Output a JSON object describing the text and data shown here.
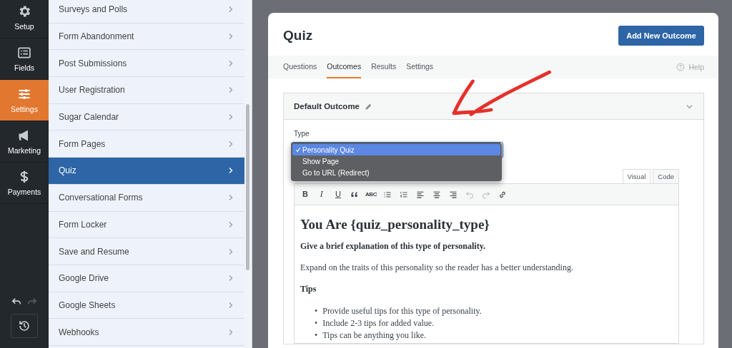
{
  "nav": [
    {
      "label": "Setup",
      "selected": false
    },
    {
      "label": "Fields",
      "selected": false
    },
    {
      "label": "Settings",
      "selected": true
    },
    {
      "label": "Marketing",
      "selected": false
    },
    {
      "label": "Payments",
      "selected": false
    }
  ],
  "nav_footer": {
    "undo_disabled": false,
    "redo_disabled": true
  },
  "menu": [
    {
      "label": "Surveys and Polls",
      "selected": false
    },
    {
      "label": "Form Abandonment",
      "selected": false
    },
    {
      "label": "Post Submissions",
      "selected": false
    },
    {
      "label": "User Registration",
      "selected": false
    },
    {
      "label": "Sugar Calendar",
      "selected": false
    },
    {
      "label": "Form Pages",
      "selected": false
    },
    {
      "label": "Quiz",
      "selected": true
    },
    {
      "label": "Conversational Forms",
      "selected": false
    },
    {
      "label": "Form Locker",
      "selected": false
    },
    {
      "label": "Save and Resume",
      "selected": false
    },
    {
      "label": "Google Drive",
      "selected": false
    },
    {
      "label": "Google Sheets",
      "selected": false
    },
    {
      "label": "Webhooks",
      "selected": false
    }
  ],
  "panel": {
    "title": "Quiz",
    "add_button": "Add New Outcome",
    "tabs": [
      {
        "label": "Questions",
        "selected": false
      },
      {
        "label": "Outcomes",
        "selected": true
      },
      {
        "label": "Results",
        "selected": false
      },
      {
        "label": "Settings",
        "selected": false
      }
    ],
    "help": "Help",
    "outcome": {
      "title": "Default Outcome",
      "expanded": true,
      "type_label": "Type",
      "options": [
        {
          "label": "Personality Quiz",
          "selected": true
        },
        {
          "label": "Show Page",
          "selected": false
        },
        {
          "label": "Go to URL (Redirect)",
          "selected": false
        }
      ],
      "editor_tabs": [
        {
          "label": "Visual",
          "selected": true
        },
        {
          "label": "Code",
          "selected": false
        }
      ],
      "toolbar": [
        {
          "kind": "bold",
          "label": "B",
          "disabled": false
        },
        {
          "kind": "italic",
          "label": "I",
          "disabled": false
        },
        {
          "kind": "underline",
          "label": "U",
          "disabled": false
        },
        {
          "kind": "quote",
          "disabled": false
        },
        {
          "kind": "strike",
          "label": "ABC",
          "disabled": false
        },
        {
          "kind": "bullets",
          "disabled": false
        },
        {
          "kind": "numbers",
          "disabled": false
        },
        {
          "kind": "align-left",
          "disabled": false
        },
        {
          "kind": "align-center",
          "disabled": false
        },
        {
          "kind": "align-right",
          "disabled": false
        },
        {
          "kind": "undo",
          "disabled": true
        },
        {
          "kind": "redo",
          "disabled": true
        },
        {
          "kind": "link",
          "disabled": false
        }
      ],
      "content": [
        {
          "kind": "heading",
          "text": "You Are {quiz_personality_type}"
        },
        {
          "kind": "bold",
          "text": "Give a brief explanation of this type of personality."
        },
        {
          "kind": "paragraph",
          "text": "Expand on the traits of this personality so the reader has a better understanding."
        },
        {
          "kind": "bold",
          "text": "Tips"
        },
        {
          "kind": "bullets",
          "marker": "•",
          "items": [
            "Provide useful tips for this type of personality.",
            "Include 2-3 tips for added value.",
            "Tips can be anything you like."
          ]
        }
      ]
    }
  }
}
